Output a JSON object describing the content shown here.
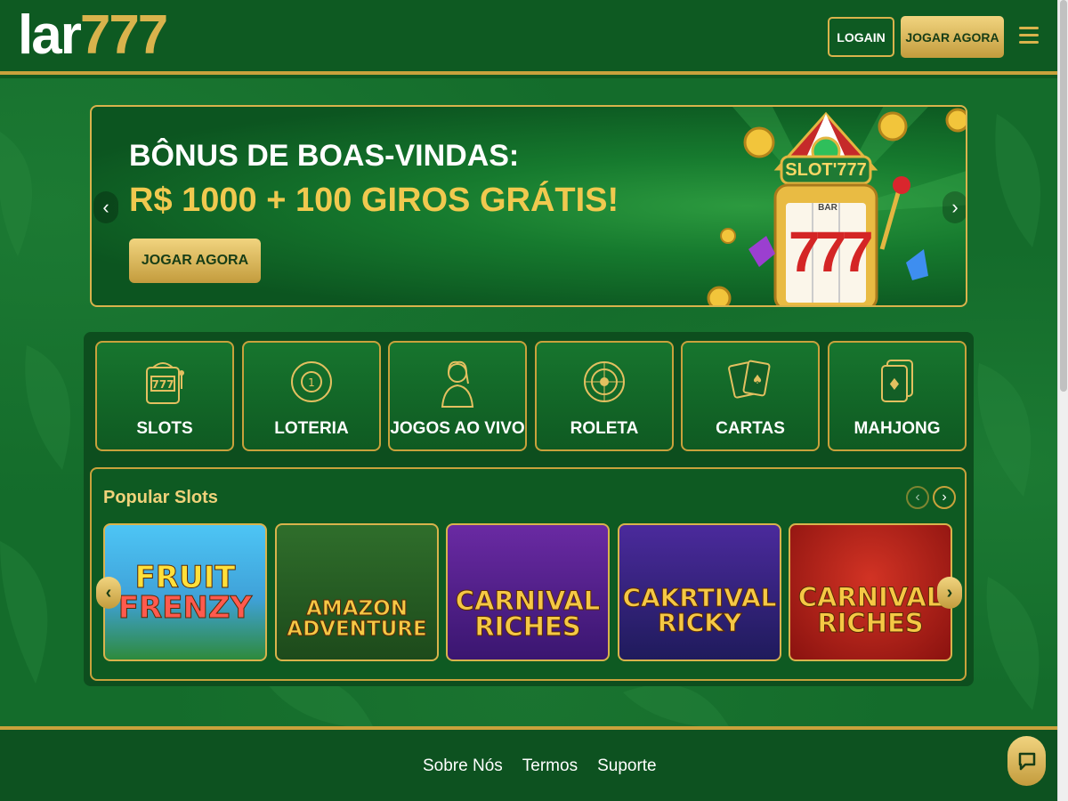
{
  "header": {
    "logo_main": "lar",
    "logo_accent": "777",
    "login_label": "LOGAIN",
    "play_label": "JOGAR AGORA",
    "menu_icon": "hamburger-menu-icon"
  },
  "hero": {
    "title": "BÔNUS DE BOAS-VINDAS:",
    "subtitle": "R$ 1000 + 100 GIROS GRÁTIS!",
    "button_label": "JOGAR AGORA",
    "slot_sign": "SLOT'777",
    "reel_symbol": "7",
    "reel_bar": "BAR",
    "prev_icon": "chevron-left-icon",
    "next_icon": "chevron-right-icon"
  },
  "categories": [
    {
      "label": "SLOTS",
      "icon": "slot-machine-icon"
    },
    {
      "label": "LOTERIA",
      "icon": "lottery-ball-icon"
    },
    {
      "label": "JOGOS AO VIVO",
      "icon": "live-dealer-icon"
    },
    {
      "label": "ROLETA",
      "icon": "roulette-icon"
    },
    {
      "label": "CARTAS",
      "icon": "playing-cards-icon"
    },
    {
      "label": "MAHJONG",
      "icon": "mahjong-tile-icon"
    }
  ],
  "popular": {
    "title": "Popular Slots",
    "games": [
      {
        "line1": "FRUIT",
        "line2": "FRENZY"
      },
      {
        "line1": "AMAZON",
        "line2": "ADVENTURE"
      },
      {
        "line1": "CARNIVAL",
        "line2": "RICHES"
      },
      {
        "line1": "CAKRTIVAL",
        "line2": "RICKY"
      },
      {
        "line1": "CARNIVAL",
        "line2": "RICHES"
      }
    ]
  },
  "footer": {
    "links": [
      "Sobre Nós",
      "Termos",
      "Suporte"
    ],
    "chat_icon": "chat-bubble-icon"
  },
  "colors": {
    "green": "#0e5a22",
    "gold": "#d9b34c",
    "hero_yellow": "#f0c94f"
  }
}
